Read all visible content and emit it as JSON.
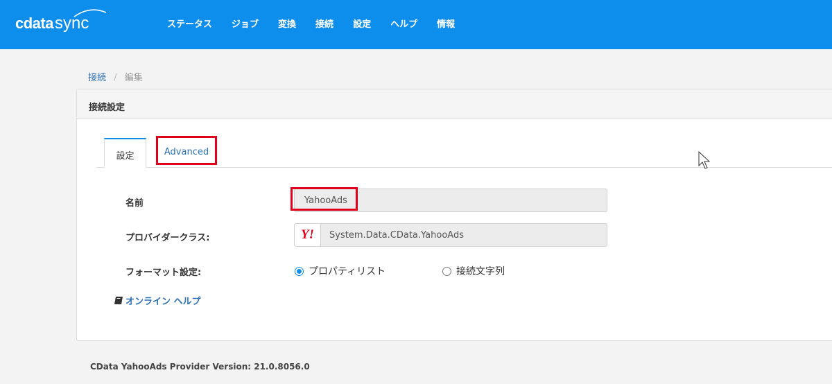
{
  "header": {
    "brand": "cdata",
    "product": "sync",
    "nav": [
      "ステータス",
      "ジョブ",
      "変換",
      "接続",
      "設定",
      "ヘルプ",
      "情報"
    ],
    "bg_color": "#0e8eec"
  },
  "breadcrumb": {
    "parent": "接続",
    "separator": "/",
    "current": "編集"
  },
  "card": {
    "title": "接続設定",
    "tabs": [
      {
        "label": "設定",
        "active": true
      },
      {
        "label": "Advanced",
        "active": false,
        "highlighted": true
      }
    ]
  },
  "form": {
    "name_label": "名前",
    "name_value": "YahooAds",
    "provider_label": "プロバイダークラス:",
    "provider_icon": "yahoo-logo-icon",
    "provider_logo_text": "Y!",
    "provider_value": "System.Data.CData.YahooAds",
    "format_label": "フォーマット設定:",
    "format_options": [
      {
        "label": "プロパティリスト",
        "selected": true
      },
      {
        "label": "接続文字列",
        "selected": false
      }
    ]
  },
  "help_link": "オンライン ヘルプ",
  "footer": "CData YahooAds Provider Version: 21.0.8056.0",
  "colors": {
    "accent": "#0e8eec",
    "highlight": "#e0001b",
    "link": "#2b6fb3"
  }
}
